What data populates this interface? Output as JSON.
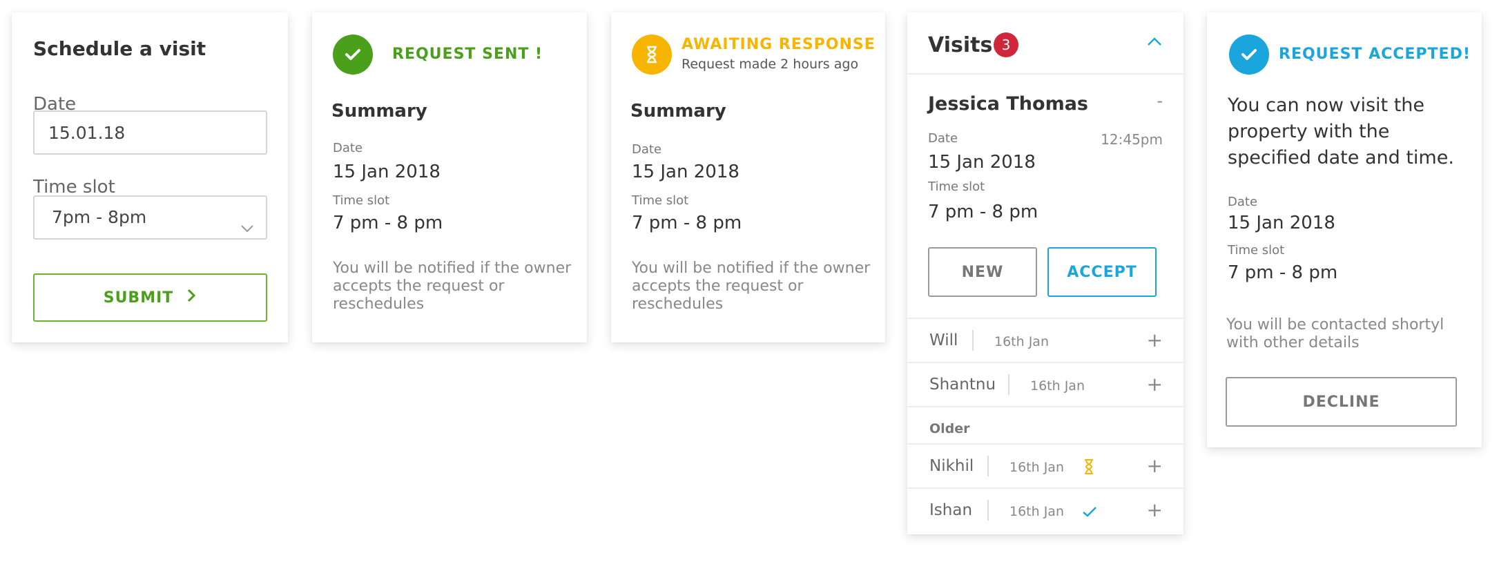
{
  "schedule": {
    "title": "Schedule a visit",
    "date_label": "Date",
    "date_value": "15.01.18",
    "timeslot_label": "Time slot",
    "timeslot_value": "7pm - 8pm",
    "submit_label": "SUBMIT"
  },
  "sent": {
    "status": "REQUEST SENT !",
    "summary_title": "Summary",
    "date_label": "Date",
    "date_value": "15 Jan 2018",
    "timeslot_label": "Time slot",
    "timeslot_value": "7 pm - 8 pm",
    "note": "You will be notified if the owner accepts the request or reschedules"
  },
  "awaiting": {
    "status": "AWAITING RESPONSE",
    "subtitle": "Request made 2 hours ago",
    "summary_title": "Summary",
    "date_label": "Date",
    "date_value": "15 Jan 2018",
    "timeslot_label": "Time slot",
    "timeslot_value": "7 pm - 8 pm",
    "note": "You will be notified if the owner accepts the request or reschedules"
  },
  "visits": {
    "title": "Visits",
    "badge_count": "3",
    "expanded": {
      "name": "Jessica Thomas",
      "collapse_symbol": "-",
      "time": "12:45pm",
      "date_label": "Date",
      "date_value": "15 Jan 2018",
      "timeslot_label": "Time slot",
      "timeslot_value": "7 pm - 8 pm",
      "new_label": "NEW",
      "accept_label": "ACCEPT"
    },
    "recent": [
      {
        "name": "Will",
        "date": "16th Jan",
        "expand": "+"
      },
      {
        "name": "Shantnu",
        "date": "16th Jan",
        "expand": "+"
      }
    ],
    "older_label": "Older",
    "older": [
      {
        "name": "Nikhil",
        "date": "16th Jan",
        "status_icon": "hourglass-icon",
        "expand": "+"
      },
      {
        "name": "Ishan",
        "date": "16th Jan",
        "status_icon": "check-icon",
        "expand": "+"
      }
    ]
  },
  "accepted": {
    "status": "REQUEST ACCEPTED!",
    "message": "You can now visit the property with the specified date and time.",
    "date_label": "Date",
    "date_value": "15 Jan 2018",
    "timeslot_label": "Time slot",
    "timeslot_value": "7 pm - 8 pm",
    "note": "You will be contacted shortyl with other details",
    "decline_label": "DECLINE"
  },
  "colors": {
    "green": "#4aa01a",
    "amber": "#f7b500",
    "blue": "#1aa6dd",
    "badge_red": "#d0263b"
  }
}
